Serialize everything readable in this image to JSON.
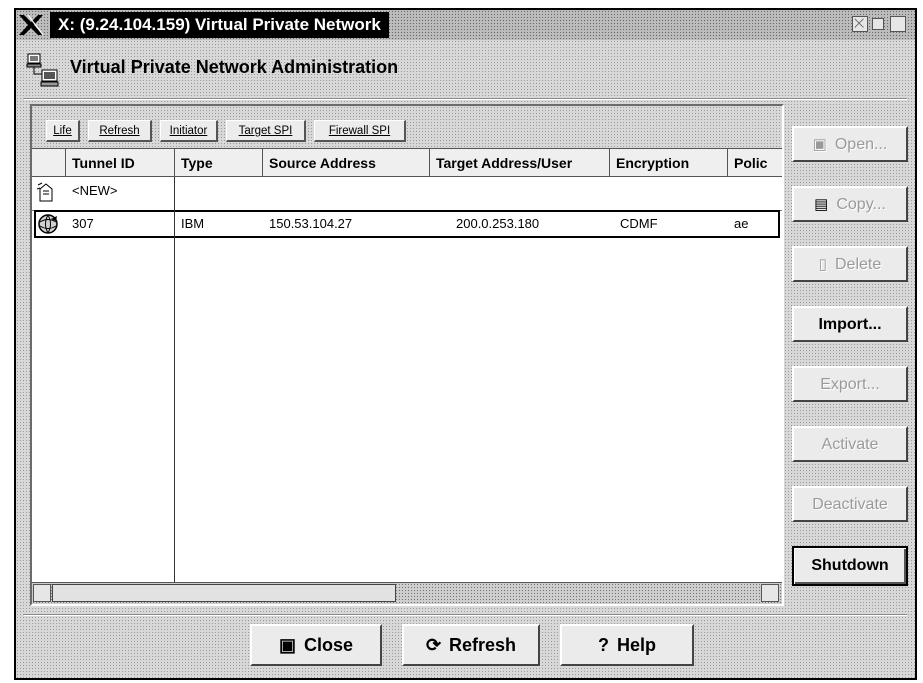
{
  "window": {
    "title": "X: (9.24.104.159) Virtual Private Network"
  },
  "app": {
    "title": "Virtual Private Network Administration"
  },
  "tabs": [
    {
      "label": "Life"
    },
    {
      "label": "Refresh"
    },
    {
      "label": "Initiator"
    },
    {
      "label": "Target SPI"
    },
    {
      "label": "Firewall SPI"
    }
  ],
  "table": {
    "columns": [
      "",
      "Tunnel ID",
      "Type",
      "Source Address",
      "Target Address/User",
      "Encryption",
      "Polic"
    ],
    "rows": [
      {
        "icon": "new-tunnel-icon",
        "tunnel_id": "<NEW>",
        "type": "",
        "source": "",
        "target": "",
        "encryption": "",
        "policy": ""
      },
      {
        "icon": "tunnel-globe-icon",
        "tunnel_id": "307",
        "type": "IBM",
        "source": "150.53.104.27",
        "target": "200.0.253.180",
        "encryption": "CDMF",
        "policy": "ae"
      }
    ]
  },
  "side_buttons": {
    "open": "Open...",
    "copy": "Copy...",
    "delete": "Delete",
    "import": "Import...",
    "export": "Export...",
    "activate": "Activate",
    "deactivate": "Deactivate",
    "shutdown": "Shutdown"
  },
  "bottom_buttons": {
    "close": "Close",
    "refresh": "Refresh",
    "help": "Help"
  }
}
